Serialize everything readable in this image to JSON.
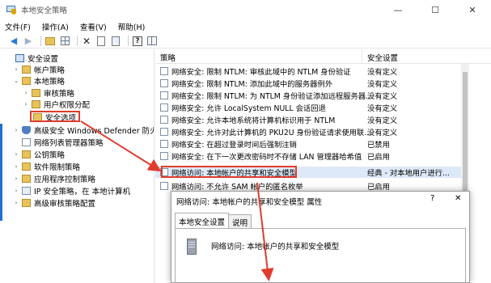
{
  "window": {
    "title": "本地安全策略",
    "controls": {
      "minimize": "—",
      "maximize": "☐",
      "close": "✕"
    }
  },
  "menu": [
    "文件(F)",
    "操作(A)",
    "查看(V)",
    "帮助(H)"
  ],
  "toolbar": {
    "icons": [
      "back-arrow-icon",
      "forward-arrow-icon",
      "folder-up-icon",
      "show-tree-icon",
      "delete-icon",
      "properties-icon",
      "export-icon",
      "help-icon",
      "panel-icon"
    ]
  },
  "tree": {
    "items": [
      {
        "label": "安全设置",
        "expander": "",
        "icon": "pc"
      },
      {
        "label": "帐户策略",
        "expander": "›",
        "icon": "folder"
      },
      {
        "label": "本地策略",
        "expander": "⌄",
        "icon": "folder"
      },
      {
        "label": "审核策略",
        "expander": "›",
        "icon": "folder"
      },
      {
        "label": "用户权限分配",
        "expander": "›",
        "icon": "folder"
      },
      {
        "label": "安全选项",
        "expander": "",
        "icon": "folder"
      },
      {
        "label": "高级安全 Windows Defender 防火墙",
        "expander": "›",
        "icon": "shield"
      },
      {
        "label": "网络列表管理器策略",
        "expander": "",
        "icon": "doc"
      },
      {
        "label": "公钥策略",
        "expander": "›",
        "icon": "folder"
      },
      {
        "label": "软件限制策略",
        "expander": "›",
        "icon": "folder"
      },
      {
        "label": "应用程序控制策略",
        "expander": "›",
        "icon": "folder"
      },
      {
        "label": "IP 安全策略，在 本地计算机",
        "expander": "›",
        "icon": "net"
      },
      {
        "label": "高级审核策略配置",
        "expander": "›",
        "icon": "folder"
      }
    ]
  },
  "list": {
    "columns": {
      "policy": "策略",
      "setting": "安全设置"
    },
    "rows": [
      {
        "policy": "网络安全: 限制 NTLM: 审核此域中的 NTLM 身份验证",
        "setting": "没有定义"
      },
      {
        "policy": "网络安全: 限制 NTLM: 添加此域中的服务器例外",
        "setting": "没有定义"
      },
      {
        "policy": "网络安全: 限制 NTLM: 为 NTLM 身份验证添加远程服务器...",
        "setting": "没有定义"
      },
      {
        "policy": "网络安全: 允许 LocalSystem NULL 会话回退",
        "setting": "没有定义"
      },
      {
        "policy": "网络安全: 允许本地系统将计算机标识用于 NTLM",
        "setting": "没有定义"
      },
      {
        "policy": "网络安全: 允许对此计算机的 PKU2U 身份验证请求使用联...",
        "setting": "没有定义"
      },
      {
        "policy": "网络安全: 在超过登录时间后强制注销",
        "setting": "已禁用"
      },
      {
        "policy": "网络安全: 在下一次更改密码时不存储 LAN 管理器哈希值",
        "setting": "已启用"
      },
      {
        "policy": "网络访问: 本地帐户的共享和安全模型",
        "setting": "经典 - 对本地用户进行..."
      },
      {
        "policy": "网络访问: 不允许 SAM 帐户的匿名枚举",
        "setting": "已启用"
      }
    ]
  },
  "dialog": {
    "title": "网络访问: 本地帐户的共享和安全模型 属性",
    "help": "?",
    "close": "✕",
    "tabs": [
      "本地安全设置",
      "说明"
    ],
    "policy_name": "网络访问: 本地帐户的共享和安全模型"
  },
  "colors": {
    "annotation_red": "#e23b2e",
    "selection": "#dde9f8"
  }
}
